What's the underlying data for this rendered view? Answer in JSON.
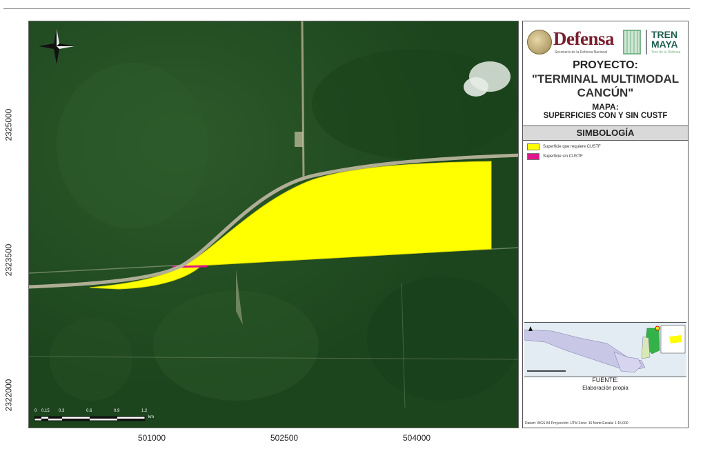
{
  "map": {
    "x_ticks": [
      "501000",
      "502500",
      "504000"
    ],
    "y_ticks": [
      "2325000",
      "2323500",
      "2322000"
    ],
    "scale_bar_labels": [
      "0",
      "0.15",
      "0.3",
      "0.6",
      "0.9",
      "1.2"
    ],
    "scale_unit": "km",
    "polygons": [
      {
        "legend": "Superficie que requiere CUSTF",
        "color": "#ffff00"
      },
      {
        "legend": "Superficie sin CUSTF",
        "color": "#e0148c"
      }
    ]
  },
  "panel": {
    "logo_defensa": "Defensa",
    "logo_defensa_sub": "Secretaría de la Defensa Nacional",
    "logo_tren": [
      "TREN",
      "MAYA"
    ],
    "logo_tren_sub": "Tren de la Defensa",
    "project_label": "PROYECTO:",
    "project_name": [
      "\"TERMINAL MULTIMODAL",
      "CANCÚN\""
    ],
    "map_label": "MAPA:",
    "map_name": "SUPERFICIES CON Y SIN CUSTF",
    "legend_title": "SIMBOLOGÍA",
    "legend": [
      {
        "label": "Superficie que requiere CUSTF",
        "color": "#ffff00"
      },
      {
        "label": "Superficie sin CUSTF",
        "color": "#e0148c"
      }
    ],
    "fuente_label": "FUENTE:",
    "fuente_text": "Elaboración propia",
    "datum": "Datum: WGS 84  Proyección: UTM Zone: 16 Norte   Escala: 1:15,000"
  }
}
